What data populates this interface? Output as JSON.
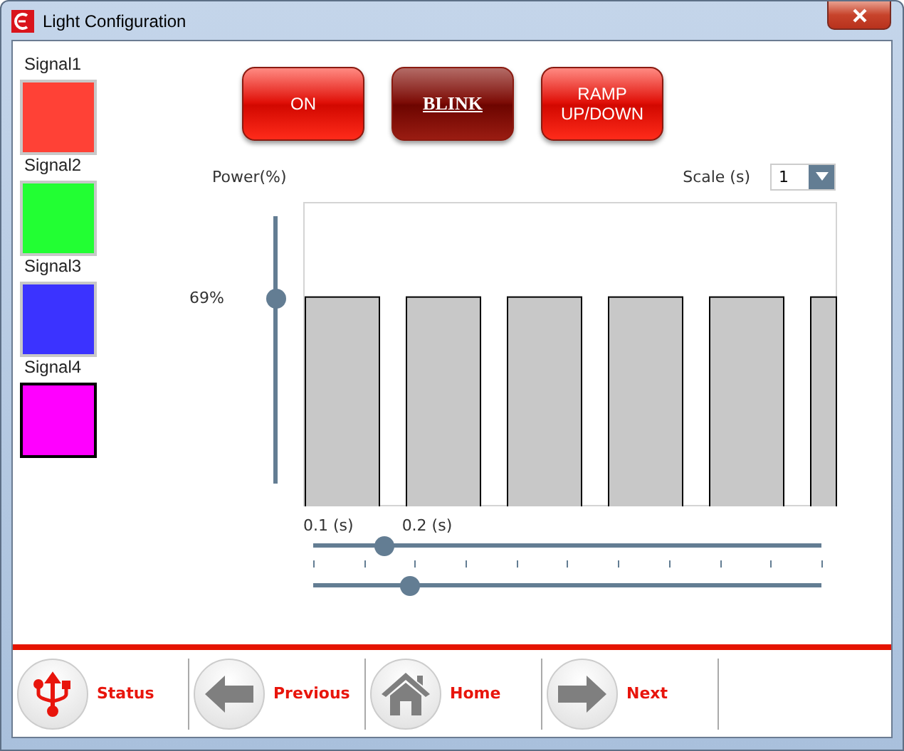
{
  "window": {
    "title": "Light Configuration"
  },
  "signals": [
    {
      "label": "Signal1",
      "color": "#ff4136",
      "selected": false
    },
    {
      "label": "Signal2",
      "color": "#22ff33",
      "selected": false
    },
    {
      "label": "Signal3",
      "color": "#3b33ff",
      "selected": false
    },
    {
      "label": "Signal4",
      "color": "#ff00ff",
      "selected": true
    }
  ],
  "modes": [
    {
      "label": "ON",
      "selected": false
    },
    {
      "label": "BLINK",
      "selected": true
    },
    {
      "label": "RAMP UP/DOWN",
      "selected": false
    }
  ],
  "power": {
    "label": "Power(%)",
    "level": 0.69,
    "reading": "69%"
  },
  "scale": {
    "label": "Scale (s)",
    "value": "1"
  },
  "timing": [
    {
      "label": "0.1 (s)",
      "level": 0.14
    },
    {
      "label": "0.2 (s)",
      "level": 0.19
    }
  ],
  "nav": [
    {
      "label": "Status",
      "kind": "usb"
    },
    {
      "label": "Previous",
      "kind": "back"
    },
    {
      "label": "Home",
      "kind": "home"
    },
    {
      "label": "Next",
      "kind": "forward"
    }
  ]
}
